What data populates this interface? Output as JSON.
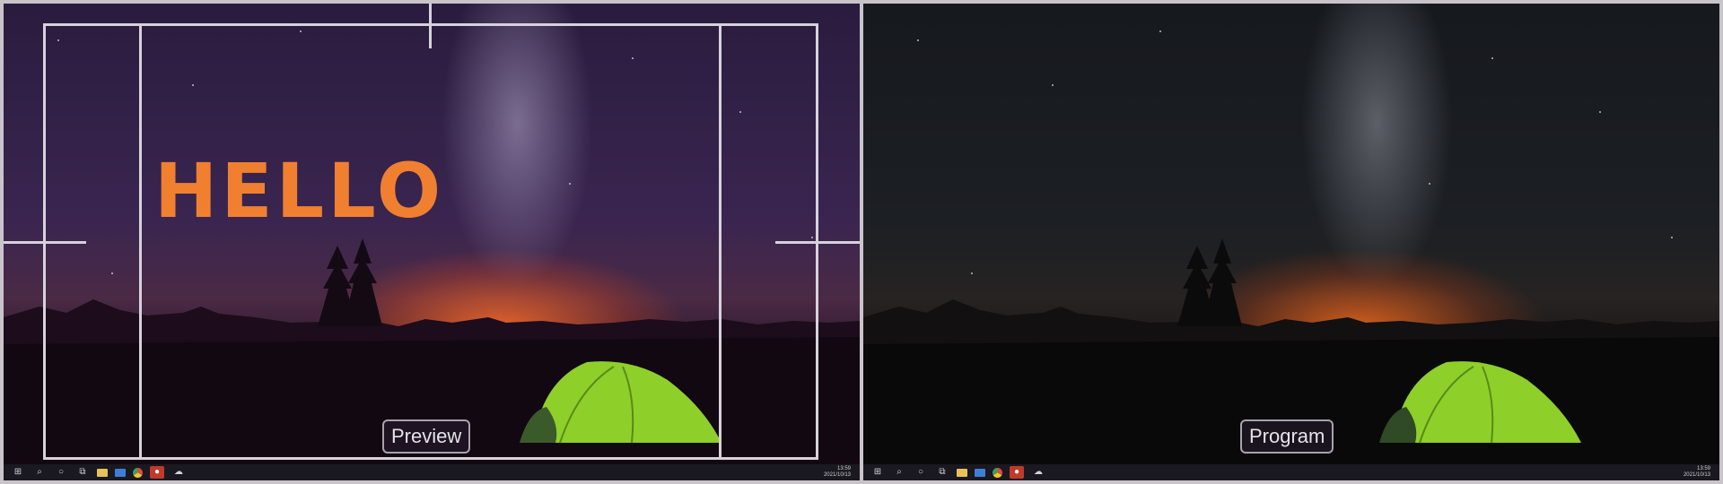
{
  "preview": {
    "label": "Preview",
    "overlay_title": "HELLO",
    "taskbar": {
      "clock_time": "13:59",
      "clock_date": "2021/10/13"
    }
  },
  "program": {
    "label": "Program",
    "taskbar": {
      "clock_time": "13:59",
      "clock_date": "2021/10/13"
    }
  },
  "icons": [
    "windows-start-icon",
    "search-icon",
    "cortana-icon",
    "task-view-icon",
    "file-explorer-icon",
    "mail-icon",
    "chrome-icon",
    "app-icon",
    "cloud-app-icon"
  ],
  "colors": {
    "title_text": "#f08030",
    "guide_lines": "#d6d2dc",
    "frame_bg": "#c9c4ca",
    "tent": "#8ecf2a"
  }
}
